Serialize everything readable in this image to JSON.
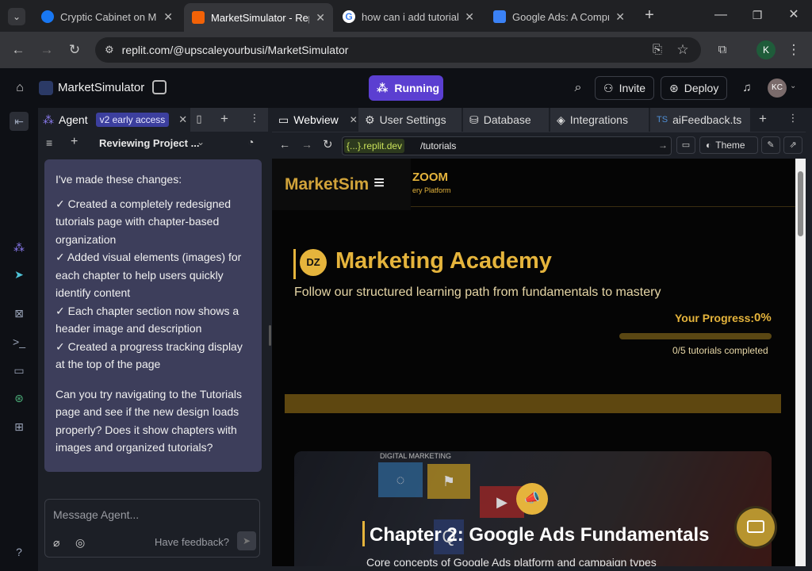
{
  "browser": {
    "tabs": [
      {
        "title": "Cryptic Cabinet on Meta",
        "favicon_color": "#1877f2"
      },
      {
        "title": "MarketSimulator - Replit",
        "favicon_color": "#f26207"
      },
      {
        "title": "how can i add tutorial",
        "favicon_color": "#4285f4"
      },
      {
        "title": "Google Ads: A Compre",
        "favicon_color": "#3b82f6"
      }
    ],
    "url": "replit.com/@upscaleyourbusi/MarketSimulator",
    "profile_initial": "K"
  },
  "replit": {
    "project_name": "MarketSimulator",
    "run_label": "Running",
    "invite_label": "Invite",
    "deploy_label": "Deploy",
    "avatar_initials": "KC"
  },
  "agent": {
    "tab_label": "Agent",
    "badge": "v2 early access",
    "thread_title": "Reviewing Project ...",
    "message": {
      "intro": "I've made these changes:",
      "changes": [
        "✓ Created a completely redesigned tutorials page with chapter-based organization",
        "✓ Added visual elements (images) for each chapter to help users quickly identify content",
        "✓ Each chapter section now shows a header image and description",
        "✓ Created a progress tracking display at the top of the page"
      ],
      "question": "Can you try navigating to the Tutorials page and see if the new design loads properly? Does it show chapters with images and organized tutorials?"
    },
    "input_placeholder": "Message Agent...",
    "feedback_label": "Have feedback?"
  },
  "webview": {
    "tabs": [
      "Webview",
      "User Settings",
      "Database",
      "Integrations",
      "aiFeedback.ts"
    ],
    "domain": "{...}.replit.dev",
    "path": "/tutorials",
    "theme_label": "Theme"
  },
  "site": {
    "brand": "MarketSim",
    "zoom_brand": "ZOOM",
    "zoom_sub": "ery Platform",
    "badge_initials": "DZ",
    "academy_title": "Marketing Academy",
    "academy_subtitle": "Follow our structured learning path from fundamentals to mastery",
    "progress_label": "Your Progress:",
    "progress_value": "0%",
    "progress_fraction": 0,
    "completed_text": "0/5 tutorials completed",
    "chapter_title": "Chapter 2: Google Ads Fundamentals",
    "chapter_desc": "Core concepts of Google Ads platform and campaign types",
    "image_caption": "DIGITAL MARKETING"
  },
  "colors": {
    "accent_gold": "#e5b43c",
    "run_purple": "#5b3fd1",
    "agent_bubble": "#3d3e5b"
  }
}
